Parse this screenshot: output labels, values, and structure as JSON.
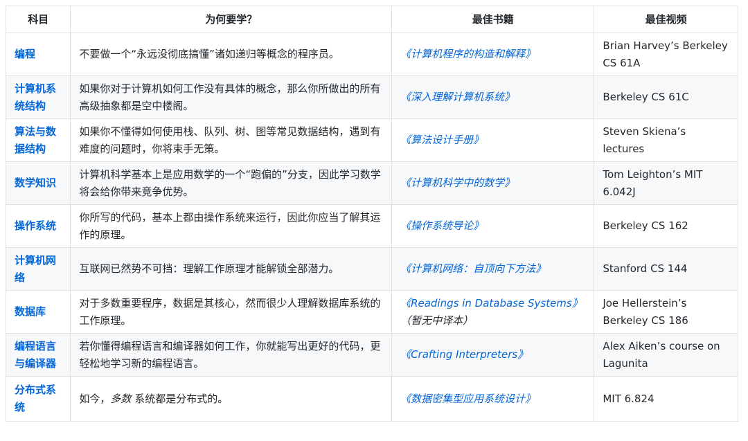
{
  "headers": [
    "科目",
    "为何要学？",
    "最佳书籍",
    "最佳视频"
  ],
  "rows": [
    {
      "subject": "编程",
      "why": "不要做一个“永远没彻底搞懂”诸如递归等概念的程序员。",
      "book": "《计算机程序的构造和解释》",
      "book_note": "",
      "video": "Brian Harvey’s Berkeley CS 61A"
    },
    {
      "subject": "计算机系统结构",
      "why": "如果你对于计算机如何工作没有具体的概念，那么你所做出的所有高级抽象都是空中楼阁。",
      "book": "《深入理解计算机系统》",
      "book_note": "",
      "video": "Berkeley CS 61C"
    },
    {
      "subject": "算法与数据结构",
      "why": "如果你不懂得如何使用栈、队列、树、图等常见数据结构，遇到有难度的问题时，你将束手无策。",
      "book": "《算法设计手册》",
      "book_note": "",
      "video": "Steven Skiena’s lectures"
    },
    {
      "subject": "数学知识",
      "why": "计算机科学基本上是应用数学的一个“跑偏的”分支，因此学习数学将会给你带来竞争优势。",
      "book": "《计算机科学中的数学》",
      "book_note": "",
      "video": "Tom Leighton’s MIT 6.042J"
    },
    {
      "subject": "操作系统",
      "why": "你所写的代码，基本上都由操作系统来运行，因此你应当了解其运作的原理。",
      "book": "《操作系统导论》",
      "book_note": "",
      "video": "Berkeley CS 162"
    },
    {
      "subject": "计算机网络",
      "why": "互联网已然势不可挡：理解工作原理才能解锁全部潜力。",
      "book": "《计算机网络：自顶向下方法》",
      "book_note": "",
      "video": "Stanford CS 144"
    },
    {
      "subject": "数据库",
      "why": "对于多数重要程序，数据是其核心，然而很少人理解数据库系统的工作原理。",
      "book": "《Readings in Database Systems》",
      "book_note": "（暂无中译本）",
      "video": "Joe Hellerstein’s Berkeley CS 186"
    },
    {
      "subject": "编程语言与编译器",
      "why": "若你懂得编程语言和编译器如何工作，你就能写出更好的代码，更轻松地学习新的编程语言。",
      "book": "《Crafting Interpreters》",
      "book_note": "",
      "video": "Alex Aiken’s course on Lagunita"
    },
    {
      "subject": "分布式系统",
      "why_prefix": "如今，",
      "why_em": "多数",
      "why_suffix": " 系统都是分布式的。",
      "book": "《数据密集型应用系统设计》",
      "book_note": "",
      "video": "MIT 6.824"
    }
  ]
}
